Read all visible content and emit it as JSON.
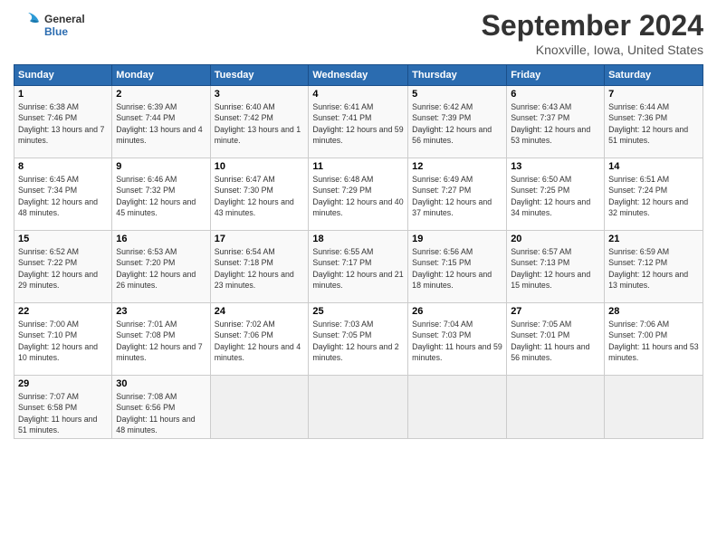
{
  "header": {
    "logo_line1": "General",
    "logo_line2": "Blue",
    "month": "September 2024",
    "location": "Knoxville, Iowa, United States"
  },
  "days_of_week": [
    "Sunday",
    "Monday",
    "Tuesday",
    "Wednesday",
    "Thursday",
    "Friday",
    "Saturday"
  ],
  "weeks": [
    [
      {
        "day": "1",
        "sunrise": "6:38 AM",
        "sunset": "7:46 PM",
        "daylight": "13 hours and 7 minutes."
      },
      {
        "day": "2",
        "sunrise": "6:39 AM",
        "sunset": "7:44 PM",
        "daylight": "13 hours and 4 minutes."
      },
      {
        "day": "3",
        "sunrise": "6:40 AM",
        "sunset": "7:42 PM",
        "daylight": "13 hours and 1 minute."
      },
      {
        "day": "4",
        "sunrise": "6:41 AM",
        "sunset": "7:41 PM",
        "daylight": "12 hours and 59 minutes."
      },
      {
        "day": "5",
        "sunrise": "6:42 AM",
        "sunset": "7:39 PM",
        "daylight": "12 hours and 56 minutes."
      },
      {
        "day": "6",
        "sunrise": "6:43 AM",
        "sunset": "7:37 PM",
        "daylight": "12 hours and 53 minutes."
      },
      {
        "day": "7",
        "sunrise": "6:44 AM",
        "sunset": "7:36 PM",
        "daylight": "12 hours and 51 minutes."
      }
    ],
    [
      {
        "day": "8",
        "sunrise": "6:45 AM",
        "sunset": "7:34 PM",
        "daylight": "12 hours and 48 minutes."
      },
      {
        "day": "9",
        "sunrise": "6:46 AM",
        "sunset": "7:32 PM",
        "daylight": "12 hours and 45 minutes."
      },
      {
        "day": "10",
        "sunrise": "6:47 AM",
        "sunset": "7:30 PM",
        "daylight": "12 hours and 43 minutes."
      },
      {
        "day": "11",
        "sunrise": "6:48 AM",
        "sunset": "7:29 PM",
        "daylight": "12 hours and 40 minutes."
      },
      {
        "day": "12",
        "sunrise": "6:49 AM",
        "sunset": "7:27 PM",
        "daylight": "12 hours and 37 minutes."
      },
      {
        "day": "13",
        "sunrise": "6:50 AM",
        "sunset": "7:25 PM",
        "daylight": "12 hours and 34 minutes."
      },
      {
        "day": "14",
        "sunrise": "6:51 AM",
        "sunset": "7:24 PM",
        "daylight": "12 hours and 32 minutes."
      }
    ],
    [
      {
        "day": "15",
        "sunrise": "6:52 AM",
        "sunset": "7:22 PM",
        "daylight": "12 hours and 29 minutes."
      },
      {
        "day": "16",
        "sunrise": "6:53 AM",
        "sunset": "7:20 PM",
        "daylight": "12 hours and 26 minutes."
      },
      {
        "day": "17",
        "sunrise": "6:54 AM",
        "sunset": "7:18 PM",
        "daylight": "12 hours and 23 minutes."
      },
      {
        "day": "18",
        "sunrise": "6:55 AM",
        "sunset": "7:17 PM",
        "daylight": "12 hours and 21 minutes."
      },
      {
        "day": "19",
        "sunrise": "6:56 AM",
        "sunset": "7:15 PM",
        "daylight": "12 hours and 18 minutes."
      },
      {
        "day": "20",
        "sunrise": "6:57 AM",
        "sunset": "7:13 PM",
        "daylight": "12 hours and 15 minutes."
      },
      {
        "day": "21",
        "sunrise": "6:59 AM",
        "sunset": "7:12 PM",
        "daylight": "12 hours and 13 minutes."
      }
    ],
    [
      {
        "day": "22",
        "sunrise": "7:00 AM",
        "sunset": "7:10 PM",
        "daylight": "12 hours and 10 minutes."
      },
      {
        "day": "23",
        "sunrise": "7:01 AM",
        "sunset": "7:08 PM",
        "daylight": "12 hours and 7 minutes."
      },
      {
        "day": "24",
        "sunrise": "7:02 AM",
        "sunset": "7:06 PM",
        "daylight": "12 hours and 4 minutes."
      },
      {
        "day": "25",
        "sunrise": "7:03 AM",
        "sunset": "7:05 PM",
        "daylight": "12 hours and 2 minutes."
      },
      {
        "day": "26",
        "sunrise": "7:04 AM",
        "sunset": "7:03 PM",
        "daylight": "11 hours and 59 minutes."
      },
      {
        "day": "27",
        "sunrise": "7:05 AM",
        "sunset": "7:01 PM",
        "daylight": "11 hours and 56 minutes."
      },
      {
        "day": "28",
        "sunrise": "7:06 AM",
        "sunset": "7:00 PM",
        "daylight": "11 hours and 53 minutes."
      }
    ],
    [
      {
        "day": "29",
        "sunrise": "7:07 AM",
        "sunset": "6:58 PM",
        "daylight": "11 hours and 51 minutes."
      },
      {
        "day": "30",
        "sunrise": "7:08 AM",
        "sunset": "6:56 PM",
        "daylight": "11 hours and 48 minutes."
      },
      null,
      null,
      null,
      null,
      null
    ]
  ]
}
